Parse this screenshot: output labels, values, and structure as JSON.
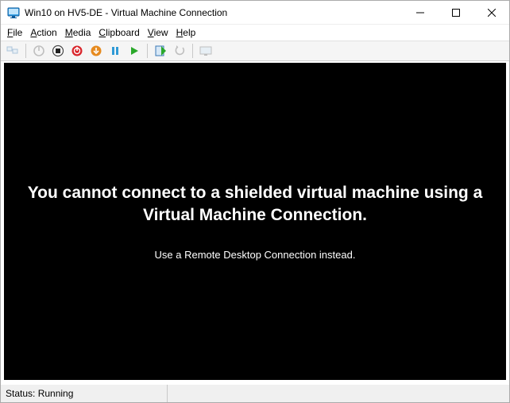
{
  "window": {
    "title": "Win10 on HV5-DE - Virtual Machine Connection"
  },
  "menu": {
    "file": "File",
    "action": "Action",
    "media": "Media",
    "clipboard": "Clipboard",
    "view": "View",
    "help": "Help"
  },
  "toolbar": {
    "ctrl_alt_del": "Ctrl+Alt+Del",
    "start": "Start",
    "turn_off": "Turn Off",
    "shut_down": "Shut Down",
    "save": "Save",
    "pause": "Pause",
    "reset": "Reset",
    "checkpoint": "Checkpoint",
    "revert": "Revert",
    "enhanced": "Enhanced Session"
  },
  "content": {
    "main_message": "You cannot connect to a shielded virtual machine using a Virtual Machine Connection.",
    "sub_message": "Use a Remote Desktop Connection instead."
  },
  "status": {
    "label": "Status",
    "value": "Running"
  }
}
